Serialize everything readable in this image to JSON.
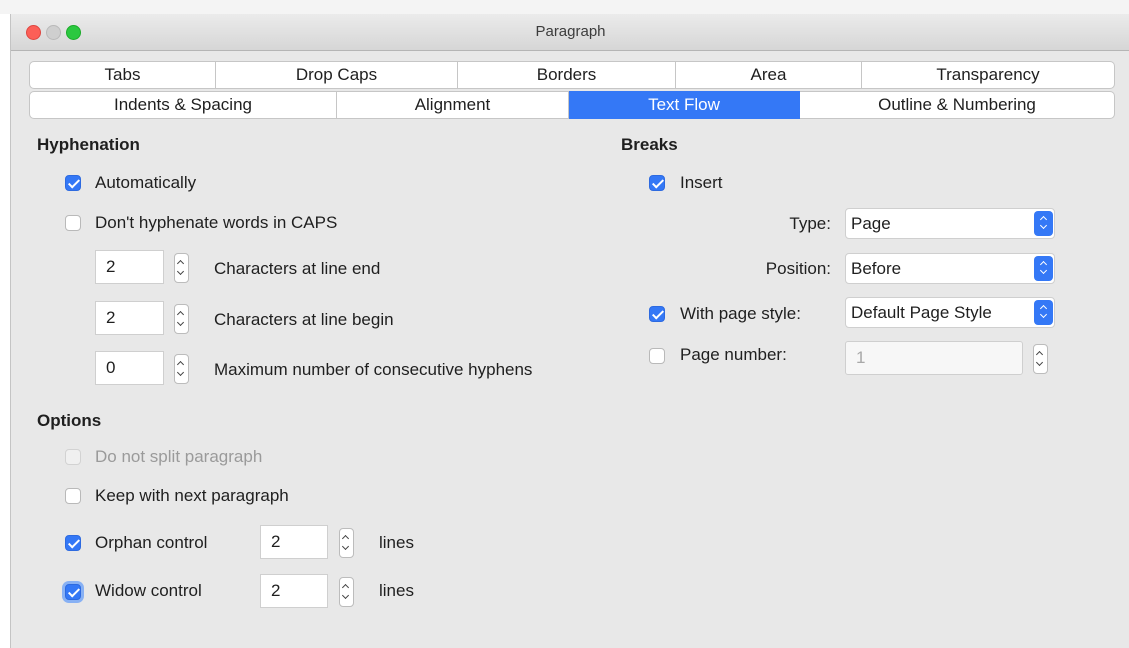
{
  "window": {
    "title": "Paragraph"
  },
  "tabs": {
    "row1": [
      "Tabs",
      "Drop Caps",
      "Borders",
      "Area",
      "Transparency"
    ],
    "row2": [
      "Indents & Spacing",
      "Alignment",
      "Text Flow",
      "Outline & Numbering"
    ],
    "active": "Text Flow"
  },
  "hyphenation": {
    "heading": "Hyphenation",
    "automatically": {
      "label": "Automatically",
      "checked": true
    },
    "dont_caps": {
      "label": "Don't hyphenate words in CAPS",
      "checked": false
    },
    "line_end": {
      "value": "2",
      "label": "Characters at line end"
    },
    "line_begin": {
      "value": "2",
      "label": "Characters at line begin"
    },
    "max_hyphens": {
      "value": "0",
      "label": "Maximum number of consecutive hyphens"
    }
  },
  "options": {
    "heading": "Options",
    "no_split": {
      "label": "Do not split paragraph",
      "checked": false,
      "disabled": true
    },
    "keep_next": {
      "label": "Keep with next paragraph",
      "checked": false
    },
    "orphan": {
      "label": "Orphan control",
      "checked": true,
      "value": "2",
      "unit": "lines"
    },
    "widow": {
      "label": "Widow control",
      "checked": true,
      "value": "2",
      "unit": "lines"
    }
  },
  "breaks": {
    "heading": "Breaks",
    "insert": {
      "label": "Insert",
      "checked": true
    },
    "type": {
      "label": "Type:",
      "value": "Page"
    },
    "position": {
      "label": "Position:",
      "value": "Before"
    },
    "page_style": {
      "label": "With page style:",
      "checked": true,
      "value": "Default Page Style"
    },
    "page_number": {
      "label": "Page number:",
      "checked": false,
      "value": "1"
    }
  },
  "colors": {
    "accent": "#3478f6",
    "dialog_bg": "#e8e8e8"
  }
}
